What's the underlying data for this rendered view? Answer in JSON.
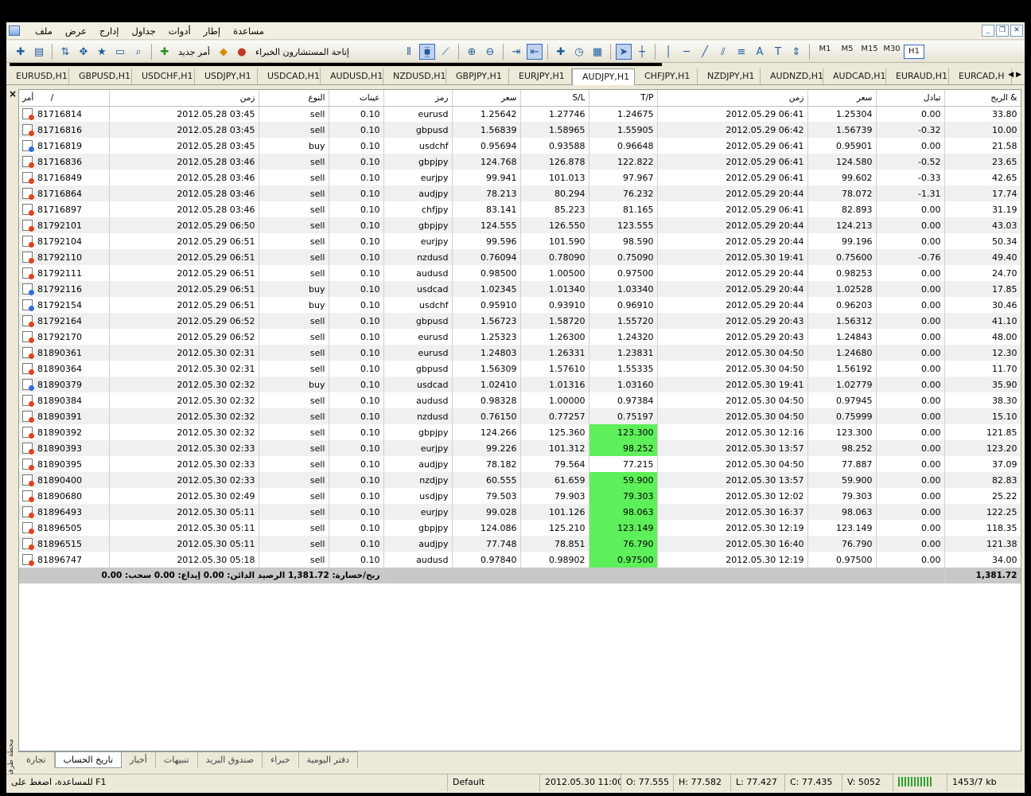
{
  "menu": [
    "ملف",
    "عرض",
    "إدارج",
    "جداول",
    "أدوات",
    "إطار",
    "مساعدة"
  ],
  "toolbar": {
    "new_order": "أمر جديد",
    "expert_advisors": "إتاحة المستشارون الخبراء",
    "timeframes": [
      "M1",
      "M5",
      "M15",
      "M30",
      "H1"
    ],
    "active_timeframe": "H1"
  },
  "chart_tabs": [
    "EURUSD,H1",
    "GBPUSD,H1",
    "USDCHF,H1",
    "USDJPY,H1",
    "USDCAD,H1",
    "AUDUSD,H1",
    "NZDUSD,H1",
    "GBPJPY,H1",
    "EURJPY,H1",
    "AUDJPY,H1",
    "CHFJPY,H1",
    "NZDJPY,H1",
    "AUDNZD,H1",
    "AUDCAD,H1",
    "EURAUD,H1",
    "EURCAD,H"
  ],
  "active_chart_tab": "AUDJPY,H1",
  "columns": {
    "order": "أمر",
    "sort": "/",
    "open_time": "زمن",
    "type": "النوع",
    "size": "عينات",
    "symbol": "رمز",
    "open_price": "سعر",
    "sl": "S/L",
    "tp": "T/P",
    "close_time": "زمن",
    "close_price": "سعر",
    "swap": "تبادل",
    "profit": "الربح &"
  },
  "rows": [
    [
      "81716814",
      "2012.05.28 03:45",
      "sell",
      "0.10",
      "eurusd",
      "1.25642",
      "1.27746",
      "1.24675",
      "2012.05.29 06:41",
      "1.25304",
      "0.00",
      "33.80"
    ],
    [
      "81716816",
      "2012.05.28 03:45",
      "sell",
      "0.10",
      "gbpusd",
      "1.56839",
      "1.58965",
      "1.55905",
      "2012.05.29 06:42",
      "1.56739",
      "-0.32",
      "10.00"
    ],
    [
      "81716819",
      "2012.05.28 03:45",
      "buy",
      "0.10",
      "usdchf",
      "0.95694",
      "0.93588",
      "0.96648",
      "2012.05.29 06:41",
      "0.95901",
      "0.00",
      "21.58"
    ],
    [
      "81716836",
      "2012.05.28 03:46",
      "sell",
      "0.10",
      "gbpjpy",
      "124.768",
      "126.878",
      "122.822",
      "2012.05.29 06:41",
      "124.580",
      "-0.52",
      "23.65"
    ],
    [
      "81716849",
      "2012.05.28 03:46",
      "sell",
      "0.10",
      "eurjpy",
      "99.941",
      "101.013",
      "97.967",
      "2012.05.29 06:41",
      "99.602",
      "-0.33",
      "42.65"
    ],
    [
      "81716864",
      "2012.05.28 03:46",
      "sell",
      "0.10",
      "audjpy",
      "78.213",
      "80.294",
      "76.232",
      "2012.05.29 20:44",
      "78.072",
      "-1.31",
      "17.74"
    ],
    [
      "81716897",
      "2012.05.28 03:46",
      "sell",
      "0.10",
      "chfjpy",
      "83.141",
      "85.223",
      "81.165",
      "2012.05.29 06:41",
      "82.893",
      "0.00",
      "31.19"
    ],
    [
      "81792101",
      "2012.05.29 06:50",
      "sell",
      "0.10",
      "gbpjpy",
      "124.555",
      "126.550",
      "123.555",
      "2012.05.29 20:44",
      "124.213",
      "0.00",
      "43.03"
    ],
    [
      "81792104",
      "2012.05.29 06:51",
      "sell",
      "0.10",
      "eurjpy",
      "99.596",
      "101.590",
      "98.590",
      "2012.05.29 20:44",
      "99.196",
      "0.00",
      "50.34"
    ],
    [
      "81792110",
      "2012.05.29 06:51",
      "sell",
      "0.10",
      "nzdusd",
      "0.76094",
      "0.78090",
      "0.75090",
      "2012.05.30 19:41",
      "0.75600",
      "-0.76",
      "49.40"
    ],
    [
      "81792111",
      "2012.05.29 06:51",
      "sell",
      "0.10",
      "audusd",
      "0.98500",
      "1.00500",
      "0.97500",
      "2012.05.29 20:44",
      "0.98253",
      "0.00",
      "24.70"
    ],
    [
      "81792116",
      "2012.05.29 06:51",
      "buy",
      "0.10",
      "usdcad",
      "1.02345",
      "1.01340",
      "1.03340",
      "2012.05.29 20:44",
      "1.02528",
      "0.00",
      "17.85"
    ],
    [
      "81792154",
      "2012.05.29 06:51",
      "buy",
      "0.10",
      "usdchf",
      "0.95910",
      "0.93910",
      "0.96910",
      "2012.05.29 20:44",
      "0.96203",
      "0.00",
      "30.46"
    ],
    [
      "81792164",
      "2012.05.29 06:52",
      "sell",
      "0.10",
      "gbpusd",
      "1.56723",
      "1.58720",
      "1.55720",
      "2012.05.29 20:43",
      "1.56312",
      "0.00",
      "41.10"
    ],
    [
      "81792170",
      "2012.05.29 06:52",
      "sell",
      "0.10",
      "eurusd",
      "1.25323",
      "1.26300",
      "1.24320",
      "2012.05.29 20:43",
      "1.24843",
      "0.00",
      "48.00"
    ],
    [
      "81890361",
      "2012.05.30 02:31",
      "sell",
      "0.10",
      "eurusd",
      "1.24803",
      "1.26331",
      "1.23831",
      "2012.05.30 04:50",
      "1.24680",
      "0.00",
      "12.30"
    ],
    [
      "81890364",
      "2012.05.30 02:31",
      "sell",
      "0.10",
      "gbpusd",
      "1.56309",
      "1.57610",
      "1.55335",
      "2012.05.30 04:50",
      "1.56192",
      "0.00",
      "11.70"
    ],
    [
      "81890379",
      "2012.05.30 02:32",
      "buy",
      "0.10",
      "usdcad",
      "1.02410",
      "1.01316",
      "1.03160",
      "2012.05.30 19:41",
      "1.02779",
      "0.00",
      "35.90"
    ],
    [
      "81890384",
      "2012.05.30 02:32",
      "sell",
      "0.10",
      "audusd",
      "0.98328",
      "1.00000",
      "0.97384",
      "2012.05.30 04:50",
      "0.97945",
      "0.00",
      "38.30"
    ],
    [
      "81890391",
      "2012.05.30 02:32",
      "sell",
      "0.10",
      "nzdusd",
      "0.76150",
      "0.77257",
      "0.75197",
      "2012.05.30 04:50",
      "0.75999",
      "0.00",
      "15.10"
    ],
    [
      "81890392",
      "2012.05.30 02:32",
      "sell",
      "0.10",
      "gbpjpy",
      "124.266",
      "125.360",
      "123.300",
      "2012.05.30 12:16",
      "123.300",
      "0.00",
      "121.85"
    ],
    [
      "81890393",
      "2012.05.30 02:33",
      "sell",
      "0.10",
      "eurjpy",
      "99.226",
      "101.312",
      "98.252",
      "2012.05.30 13:57",
      "98.252",
      "0.00",
      "123.20"
    ],
    [
      "81890395",
      "2012.05.30 02:33",
      "sell",
      "0.10",
      "audjpy",
      "78.182",
      "79.564",
      "77.215",
      "2012.05.30 04:50",
      "77.887",
      "0.00",
      "37.09"
    ],
    [
      "81890400",
      "2012.05.30 02:33",
      "sell",
      "0.10",
      "nzdjpy",
      "60.555",
      "61.659",
      "59.900",
      "2012.05.30 13:57",
      "59.900",
      "0.00",
      "82.83"
    ],
    [
      "81890680",
      "2012.05.30 02:49",
      "sell",
      "0.10",
      "usdjpy",
      "79.503",
      "79.903",
      "79.303",
      "2012.05.30 12:02",
      "79.303",
      "0.00",
      "25.22"
    ],
    [
      "81896493",
      "2012.05.30 05:11",
      "sell",
      "0.10",
      "eurjpy",
      "99.028",
      "101.126",
      "98.063",
      "2012.05.30 16:37",
      "98.063",
      "0.00",
      "122.25"
    ],
    [
      "81896505",
      "2012.05.30 05:11",
      "sell",
      "0.10",
      "gbpjpy",
      "124.086",
      "125.210",
      "123.149",
      "2012.05.30 12:19",
      "123.149",
      "0.00",
      "118.35"
    ],
    [
      "81896515",
      "2012.05.30 05:11",
      "sell",
      "0.10",
      "audjpy",
      "77.748",
      "78.851",
      "76.790",
      "2012.05.30 16:40",
      "76.790",
      "0.00",
      "121.38"
    ],
    [
      "81896747",
      "2012.05.30 05:18",
      "sell",
      "0.10",
      "audusd",
      "0.97840",
      "0.98902",
      "0.97500",
      "2012.05.30 12:19",
      "0.97500",
      "0.00",
      "34.00"
    ]
  ],
  "tp_hit_rows": [
    20,
    21,
    23,
    24,
    25,
    26,
    27,
    28
  ],
  "colors": {
    "tp_hit": "#5ef05a",
    "sell_icon": "#e2421c",
    "buy_icon": "#2f6fd8"
  },
  "summary": {
    "text": "ربح/خسارة: 1,381.72  الرصيد الدائن: 0.00  إيداع: 0.00  سحب: 0.00",
    "total": "1,381.72"
  },
  "side_title": "محطة طرفية",
  "bottom_tabs": [
    "تجارة",
    "تاريخ الحساب",
    "أخبار",
    "تنبيهات",
    "صندوق البريد",
    "خبراء",
    "دفتر اليومية"
  ],
  "active_bottom_tab": "تاريخ الحساب",
  "status": {
    "help": "للمساعدة، اضغط على F1",
    "profile": "Default",
    "datetime": "2012.05.30 11:00",
    "open": "O: 77.555",
    "high": "H: 77.582",
    "low": "L: 77.427",
    "close": "C: 77.435",
    "volume": "V: 5052",
    "traffic": "1453/7 kb"
  }
}
